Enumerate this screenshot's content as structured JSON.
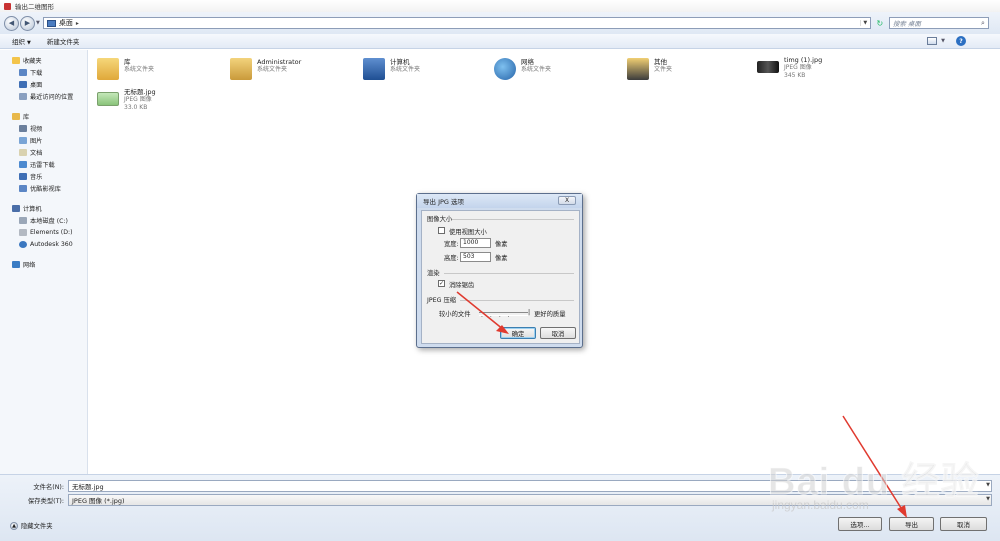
{
  "window": {
    "title": "输出二维图形"
  },
  "addressbar": {
    "location": "桌面",
    "search_placeholder": "搜索 桌面"
  },
  "toolbar": {
    "organize": "组织",
    "new_folder": "新建文件夹"
  },
  "sidebar": {
    "favorites": {
      "label": "收藏夹",
      "items": [
        "下载",
        "桌面",
        "最近访问的位置"
      ]
    },
    "libraries": {
      "label": "库",
      "items": [
        "视频",
        "图片",
        "文档",
        "迅雷下载",
        "音乐",
        "优酷影视库"
      ]
    },
    "computer": {
      "label": "计算机",
      "items": [
        "本地磁盘 (C:)",
        "Elements (D:)",
        "Autodesk 360"
      ]
    },
    "network": {
      "label": "网络"
    }
  },
  "files": [
    {
      "name": "库",
      "type": "系统文件夹",
      "size": ""
    },
    {
      "name": "Administrator",
      "type": "系统文件夹",
      "size": ""
    },
    {
      "name": "计算机",
      "type": "系统文件夹",
      "size": ""
    },
    {
      "name": "网络",
      "type": "系统文件夹",
      "size": ""
    },
    {
      "name": "其他",
      "type": "文件夹",
      "size": ""
    },
    {
      "name": "timg (1).jpg",
      "type": "JPEG 图像",
      "size": "345 KB"
    },
    {
      "name": "无标题.jpg",
      "type": "JPEG 图像",
      "size": "33.0 KB"
    }
  ],
  "footer": {
    "filename_label": "文件名(N):",
    "filename_value": "无标题.jpg",
    "filetype_label": "保存类型(T):",
    "filetype_value": "JPEG 图像 (*.jpg)",
    "hide_folders": "隐藏文件夹",
    "options_button": "选项...",
    "export_button": "导出",
    "cancel_button": "取消"
  },
  "dialog": {
    "title": "导出 JPG 选项",
    "close": "X",
    "image_size_section": "图像大小",
    "use_view_size": "使用视图大小",
    "use_view_size_checked": false,
    "width_label": "宽度:",
    "width_value": "1000",
    "height_label": "高度:",
    "height_value": "503",
    "pixels_unit": "像素",
    "render_section": "渲染",
    "antialias": "消除锯齿",
    "antialias_checked": true,
    "check_mark": "✓",
    "jpeg_section": "JPEG 压缩",
    "smaller_file": "较小的文件",
    "better_quality": "更好的质量",
    "ok_button": "确定",
    "cancel_button": "取消"
  },
  "watermark": {
    "main": "Bai du 经验",
    "sub": "jingyan.baidu.com"
  },
  "colors": {
    "accent": "#2b6fc2",
    "arrow": "#e03a2f",
    "dialog_frame": "#cfdcee"
  }
}
